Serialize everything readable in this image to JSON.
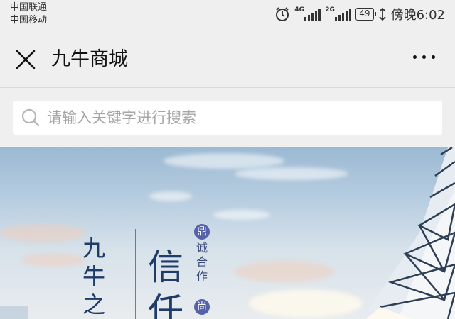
{
  "status_bar": {
    "carrier_1": "中国联通",
    "carrier_2": "中国移动",
    "net_1": "4G",
    "net_2": "2G",
    "battery": "49",
    "time": "傍晚6:02",
    "alarm_icon": "alarm-clock-icon"
  },
  "titlebar": {
    "title": "九牛商城",
    "close_icon": "close-icon",
    "more_icon": "more-dots-icon"
  },
  "search": {
    "placeholder": "请输入关键字进行搜索",
    "icon": "search-icon"
  },
  "banner": {
    "text_a": "九牛之",
    "text_b": "信任",
    "badge_a": "鼎",
    "small_text": "诚合作",
    "badge_b": "尚"
  },
  "colors": {
    "background": "#efefef",
    "title": "#111111",
    "banner_text": "#1f3b68",
    "badge": "#5561a8"
  }
}
